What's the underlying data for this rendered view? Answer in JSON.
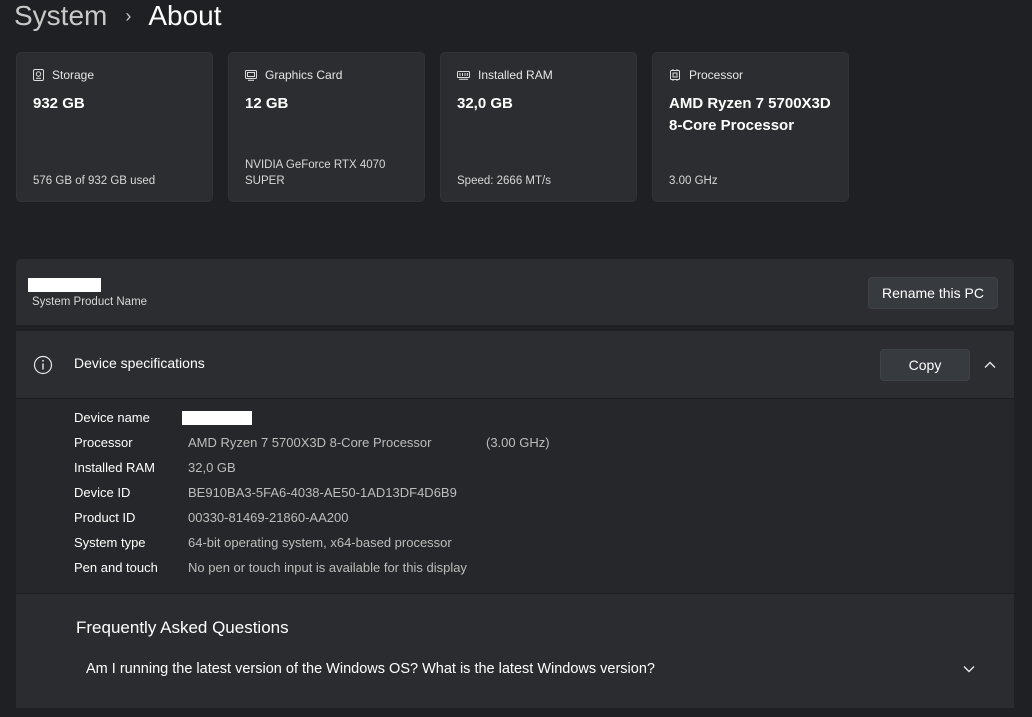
{
  "breadcrumb": {
    "parent": "System",
    "separator": "›",
    "current": "About"
  },
  "cards": [
    {
      "icon": "storage-icon",
      "label": "Storage",
      "value": "932 GB",
      "sub": "576 GB of 932 GB used"
    },
    {
      "icon": "graphics-card-icon",
      "label": "Graphics Card",
      "value": "12 GB",
      "sub": "NVIDIA GeForce RTX 4070 SUPER"
    },
    {
      "icon": "ram-icon",
      "label": "Installed RAM",
      "value": "32,0 GB",
      "sub": "Speed: 2666 MT/s"
    },
    {
      "icon": "processor-icon",
      "label": "Processor",
      "value": "AMD Ryzen 7 5700X3D 8-Core Processor",
      "sub": "3.00 GHz"
    }
  ],
  "product": {
    "label": "System Product Name",
    "rename_label": "Rename this PC"
  },
  "specs": {
    "title": "Device specifications",
    "copy_label": "Copy",
    "rows": [
      {
        "key": "Device name",
        "value": ""
      },
      {
        "key": "Processor",
        "value": "AMD Ryzen 7 5700X3D 8-Core Processor",
        "extra": "(3.00 GHz)"
      },
      {
        "key": "Installed RAM",
        "value": "32,0 GB"
      },
      {
        "key": "Device ID",
        "value": "BE910BA3-5FA6-4038-AE50-1AD13DF4D6B9"
      },
      {
        "key": "Product ID",
        "value": "00330-81469-21860-AA200"
      },
      {
        "key": "System type",
        "value": "64-bit operating system, x64-based processor"
      },
      {
        "key": "Pen and touch",
        "value": "No pen or touch input is available for this display"
      }
    ]
  },
  "faq": {
    "title": "Frequently Asked Questions",
    "question": "Am I running the latest version of the Windows OS? What is the latest Windows version?"
  },
  "colors": {
    "background": "#1e2023",
    "card": "#2b2d30",
    "button": "#373a3e"
  }
}
